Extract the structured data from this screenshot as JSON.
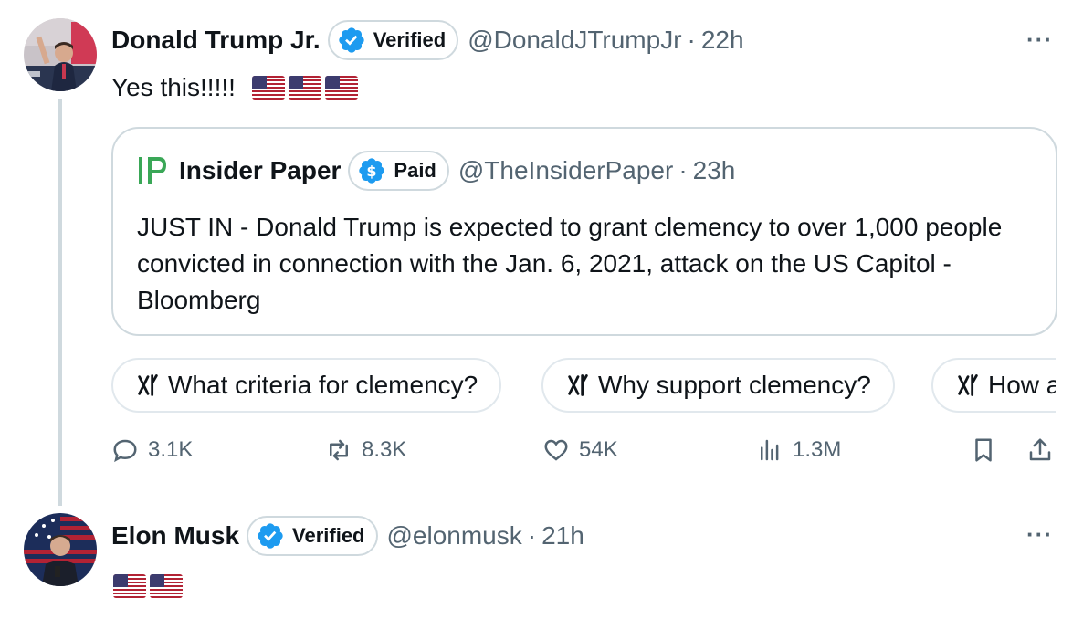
{
  "tweets": [
    {
      "author": "Donald Trump Jr.",
      "badge": "Verified",
      "handle": "@DonaldJTrumpJr",
      "separator": "·",
      "time": "22h",
      "more": "···",
      "text": "Yes this!!!!!",
      "flags": 3
    },
    {
      "author": "Elon Musk",
      "badge": "Verified",
      "handle": "@elonmusk",
      "separator": "·",
      "time": "21h",
      "more": "···",
      "text": "",
      "flags": 2
    }
  ],
  "quote": {
    "author": "Insider Paper",
    "badge": "Paid",
    "handle": "@TheInsiderPaper",
    "separator": "·",
    "time": "23h",
    "text": "JUST IN - Donald Trump is expected to grant clemency to over 1,000 people convicted in connection with the Jan. 6, 2021, attack on the US Capitol - Bloomberg"
  },
  "grok_prompts": [
    "What criteria for clemency?",
    "Why support clemency?",
    "How a"
  ],
  "actions": {
    "replies": "3.1K",
    "reposts": "8.3K",
    "likes": "54K",
    "views": "1.3M"
  },
  "colors": {
    "verified_blue": "#1d9bf0",
    "text": "#0f1419",
    "secondary": "#536471",
    "border": "#cfd9de"
  },
  "icons": [
    "verified-badge-icon",
    "paid-badge-icon",
    "more-icon",
    "grok-icon",
    "reply-icon",
    "repost-icon",
    "like-icon",
    "views-icon",
    "bookmark-icon",
    "share-icon",
    "us-flag-icon"
  ]
}
